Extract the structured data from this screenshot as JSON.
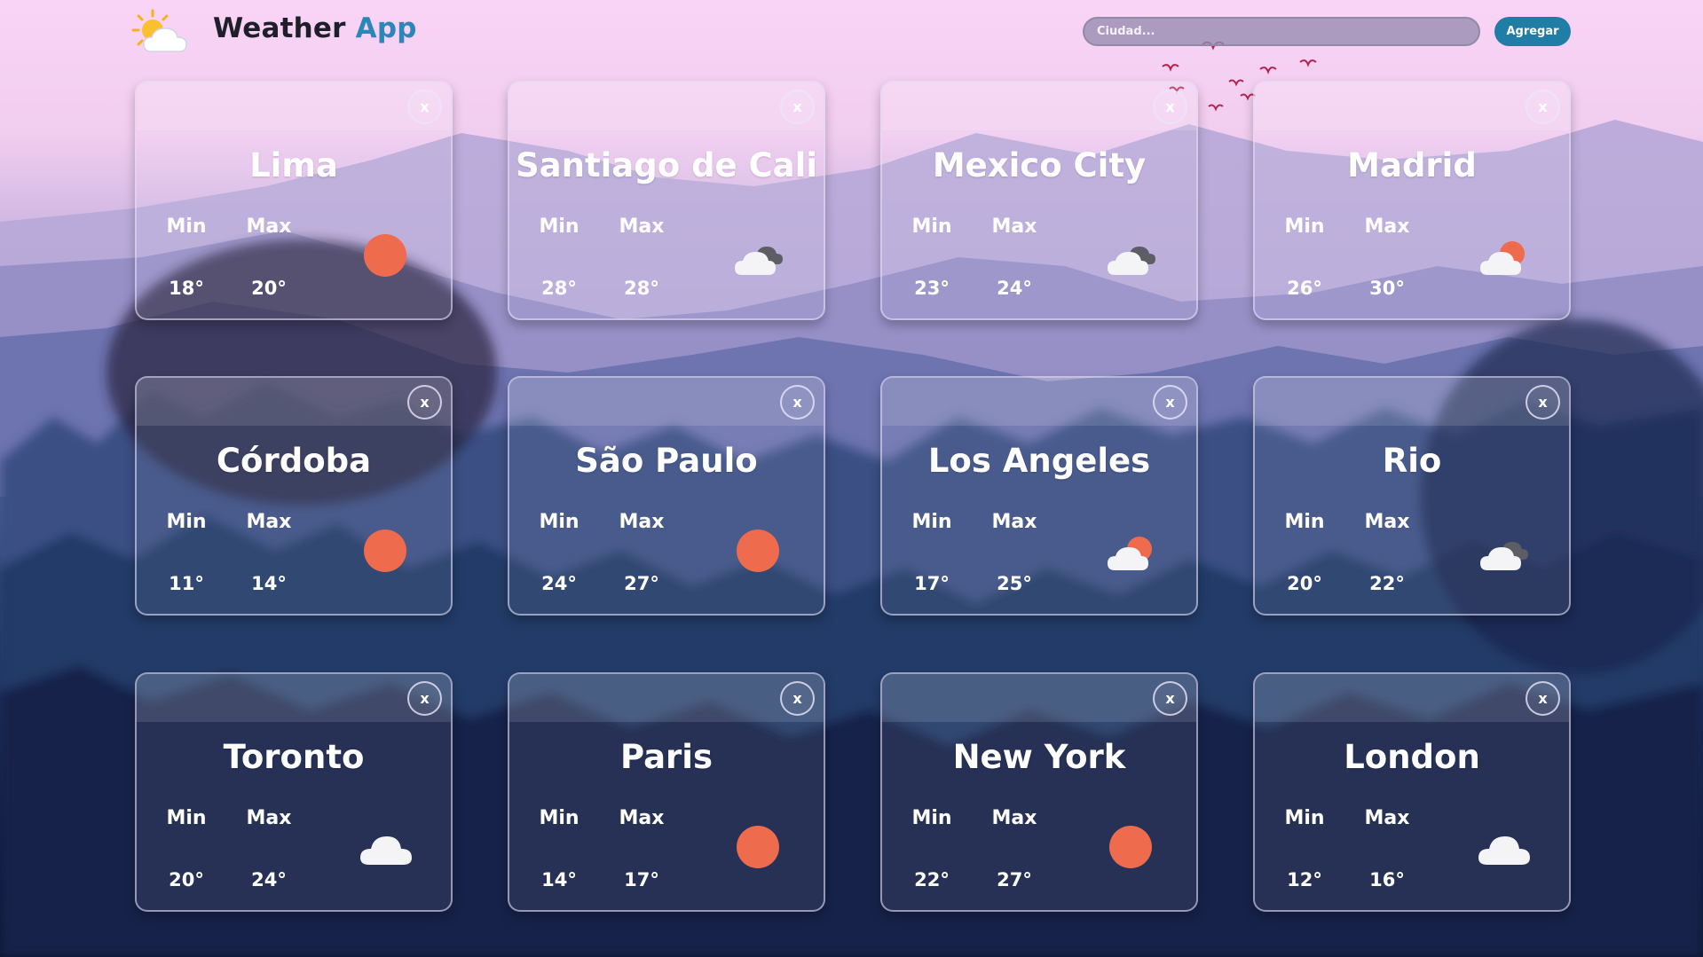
{
  "app": {
    "title_main": "Weather",
    "title_accent": "App"
  },
  "search": {
    "placeholder": "Ciudad...",
    "add_label": "Agregar"
  },
  "card_close_label": "x",
  "labels": {
    "min": "Min",
    "max": "Max"
  },
  "cities": [
    {
      "name": "Lima",
      "min": "18°",
      "max": "20°",
      "icon": "sun-icon"
    },
    {
      "name": "Santiago de Cali",
      "min": "28°",
      "max": "28°",
      "icon": "dark-clouds-icon"
    },
    {
      "name": "Mexico City",
      "min": "23°",
      "max": "24°",
      "icon": "dark-clouds-icon"
    },
    {
      "name": "Madrid",
      "min": "26°",
      "max": "30°",
      "icon": "sun-behind-cloud-icon"
    },
    {
      "name": "Córdoba",
      "min": "11°",
      "max": "14°",
      "icon": "sun-icon"
    },
    {
      "name": "São Paulo",
      "min": "24°",
      "max": "27°",
      "icon": "sun-icon"
    },
    {
      "name": "Los Angeles",
      "min": "17°",
      "max": "25°",
      "icon": "sun-behind-cloud-icon"
    },
    {
      "name": "Rio",
      "min": "20°",
      "max": "22°",
      "icon": "dark-clouds-icon"
    },
    {
      "name": "Toronto",
      "min": "20°",
      "max": "24°",
      "icon": "cloud-icon"
    },
    {
      "name": "Paris",
      "min": "14°",
      "max": "17°",
      "icon": "sun-icon"
    },
    {
      "name": "New York",
      "min": "22°",
      "max": "27°",
      "icon": "sun-icon"
    },
    {
      "name": "London",
      "min": "12°",
      "max": "16°",
      "icon": "cloud-icon"
    }
  ],
  "colors": {
    "sun": "#ef6b4e",
    "cloud": "#f4f4f6",
    "dark_cloud": "#5d5d66",
    "accent": "#2c86b8",
    "button": "#1f7da6"
  }
}
